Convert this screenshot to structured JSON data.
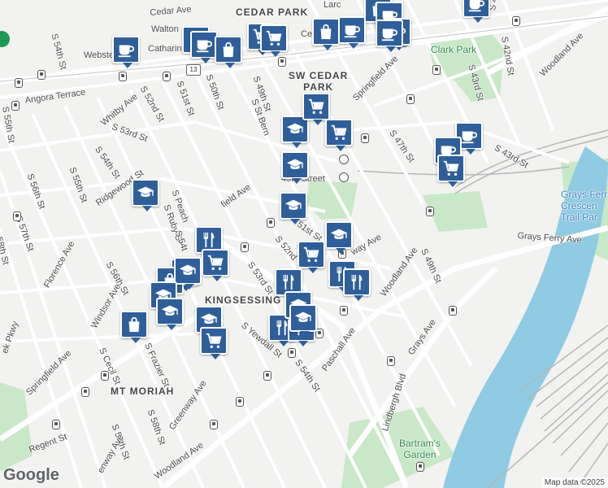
{
  "colors": {
    "land": "#f2f2f0",
    "road": "#ffffff",
    "park": "#c9e8c7",
    "water": "#8fcbe3",
    "rail": "#b7b7b7",
    "marker": "#2f5f9a"
  },
  "labels": {
    "cedar_ave": "Cedar Ave",
    "cedar_park": "CEDAR PARK",
    "walton": "Walton",
    "catharin": "Catharin",
    "webster": "Webster",
    "s_54th_top": "S 54th St",
    "s_50th": "S 50th St",
    "s_51st": "S 51st St",
    "s_49th_top": "S 49th St",
    "s_st_bern": "S St Bern",
    "sw_cedar_park": "SW CEDAR\nPARK",
    "larc": "Larc",
    "ce": "Ce",
    "springfield_ave_top": "Springfield Ave",
    "clark_park": "Clark Park",
    "s_44th": "S 44th St",
    "s_43rd_top": "S 43rd St",
    "s_42nd": "S 42nd St",
    "woodland_ave_ne": "Woodland Ave",
    "s_43rd_mid": "S 43rd St",
    "s_47th": "S 47th St",
    "angora_terrace": "Angora Terrace",
    "whitby_ave": "Whitby Ave",
    "s_52nd_top": "S 52nd St",
    "s_53rd_top": "S 53rd St",
    "s_55th_left": "S 55th St",
    "s_54th_left": "S 54th St",
    "s_55th_mid": "S 55th St",
    "s_56th": "S 56th St",
    "s_57th": "S 57th St",
    "s_58th_left": "58th St",
    "ridgewood": "Ridgewood St",
    "s_peach": "S Peach",
    "s_ruby": "S Ruby S",
    "s_54t": "S 54t",
    "springfield_mid": "field Ave",
    "street_49": "49th Street",
    "s_51st_mid": "51st St",
    "s_52nd_mid": "S 52nd",
    "chester_ave": "way Ave",
    "grays_ferry_crescent": "Grays Ferr\nCrescen\nTrail Par",
    "grays_ferry_ave": "Grays Ferry Ave",
    "woodland_ave_mid": "Woodland Ave",
    "s_49th_mid": "S 49th St",
    "florence_ave": "Florence Ave",
    "s_56th_mid": "S 56th St",
    "windsor_ave": "Windsor Ave",
    "s_53rd_mid": "S 53rd St",
    "kingsessing": "KINGSESSING",
    "s_frazier": "S Frazier St",
    "s_cecil": "S Cecil St",
    "springfield_ave_low": "Springfield Ave",
    "yewdall": "S Yewdall St",
    "s_54th_low": "S 54th St",
    "paschall_ave": "Paschall Ave",
    "grays_ave": "Grays Ave",
    "lindbergh": "Lindbergh Blvd",
    "greenway_ave": "Greenway Ave",
    "mt_moriah": "MT MORIAH",
    "s_58th_low": "S 58th St",
    "s_59th": "S 59th St",
    "regent_st": "Regent St",
    "woodland_ave_sw": "Woodland Ave",
    "ek_pkwy": "ek Pkwy",
    "bartrams": "Bartram's\nGarden",
    "enway": "enway Ave",
    "route_13": "13"
  },
  "footer": {
    "logo": "Google",
    "attribution": "Map data ©2025"
  },
  "markers": [
    {
      "icon": "cup-icon"
    },
    {
      "icon": "bag-icon"
    },
    {
      "icon": "cup-icon"
    },
    {
      "icon": "cup-icon"
    },
    {
      "icon": "cup-icon"
    },
    {
      "icon": "cart-icon"
    },
    {
      "icon": "bag-icon"
    },
    {
      "icon": "cup-icon"
    },
    {
      "icon": "cup-icon"
    },
    {
      "icon": "bag-icon"
    },
    {
      "icon": "bag-icon"
    },
    {
      "icon": "cup-icon"
    },
    {
      "icon": "cart-icon"
    },
    {
      "icon": "school-icon"
    },
    {
      "icon": "cart-icon"
    },
    {
      "icon": "cart-icon"
    },
    {
      "icon": "cup-icon"
    },
    {
      "icon": "cup-icon"
    },
    {
      "icon": "cart-icon"
    },
    {
      "icon": "school-icon"
    },
    {
      "icon": "school-icon"
    },
    {
      "icon": "school-icon"
    },
    {
      "icon": "school-icon"
    },
    {
      "icon": "utensils-icon"
    },
    {
      "icon": "cart-icon"
    },
    {
      "icon": "cart-icon"
    },
    {
      "icon": "utensils-icon"
    },
    {
      "icon": "utensils-icon"
    },
    {
      "icon": "utensils-icon"
    },
    {
      "icon": "bag-icon"
    },
    {
      "icon": "school-icon"
    },
    {
      "icon": "school-icon"
    },
    {
      "icon": "school-icon"
    },
    {
      "icon": "school-icon"
    },
    {
      "icon": "bag-icon"
    },
    {
      "icon": "school-icon"
    },
    {
      "icon": "cart-icon"
    },
    {
      "icon": "utensils-icon"
    },
    {
      "icon": "utensils-icon"
    },
    {
      "icon": "school-icon"
    },
    {
      "icon": "school-icon"
    }
  ]
}
